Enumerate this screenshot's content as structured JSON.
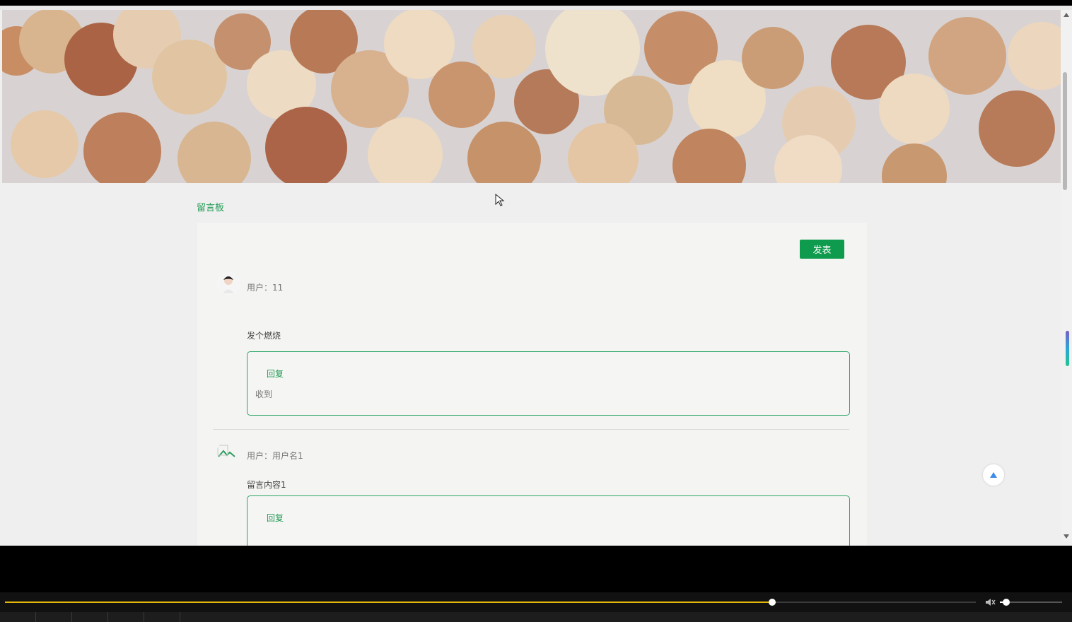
{
  "page": {
    "heading": "留言板",
    "post_button": "发表",
    "entries": [
      {
        "user_label": "用户：11",
        "message": "发个燃烧",
        "reply_title": "回复",
        "reply_text": "收到"
      },
      {
        "user_label": "用户：用户名1",
        "message": "留言内容1",
        "reply_title": "回复",
        "reply_text": ""
      }
    ]
  },
  "player": {
    "progress_fraction": 0.79,
    "volume_fraction": 0.1
  },
  "colors": {
    "accent_green": "#0f9b4d",
    "link_green": "#1f9a52",
    "progress_yellow": "#e3b707"
  },
  "icons": {
    "back_to_top": "triangle-up-icon",
    "volume": "speaker-icon",
    "scroll_up": "triangle-up-icon",
    "scroll_down": "triangle-down-icon"
  }
}
